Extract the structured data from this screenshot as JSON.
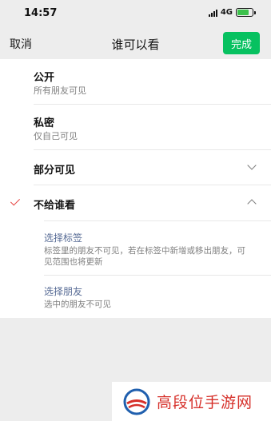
{
  "status_bar": {
    "time": "14:57",
    "network": "4G"
  },
  "nav": {
    "cancel_label": "取消",
    "title": "谁可以看",
    "done_label": "完成",
    "done_color": "#07c160"
  },
  "options": [
    {
      "title": "公开",
      "subtitle": "所有朋友可见"
    },
    {
      "title": "私密",
      "subtitle": "仅自己可见"
    },
    {
      "title": "部分可见",
      "expanded": false
    },
    {
      "title": "不给谁看",
      "selected": true,
      "expanded": true
    }
  ],
  "exclude_panel": {
    "select_tags_label": "选择标签",
    "select_tags_desc": "标签里的朋友不可见，若在标签中新增或移出朋友，可见范围也将更新",
    "select_friends_label": "选择朋友",
    "select_friends_desc": "选中的朋友不可见"
  },
  "watermark": {
    "text": "高段位手游网"
  },
  "icons": {
    "selected_check": "check-icon",
    "collapsed": "chevron-down-icon",
    "expanded": "chevron-up-icon"
  },
  "colors": {
    "check": "#e64340",
    "link": "#576b95",
    "watermark": "#d6302a"
  }
}
